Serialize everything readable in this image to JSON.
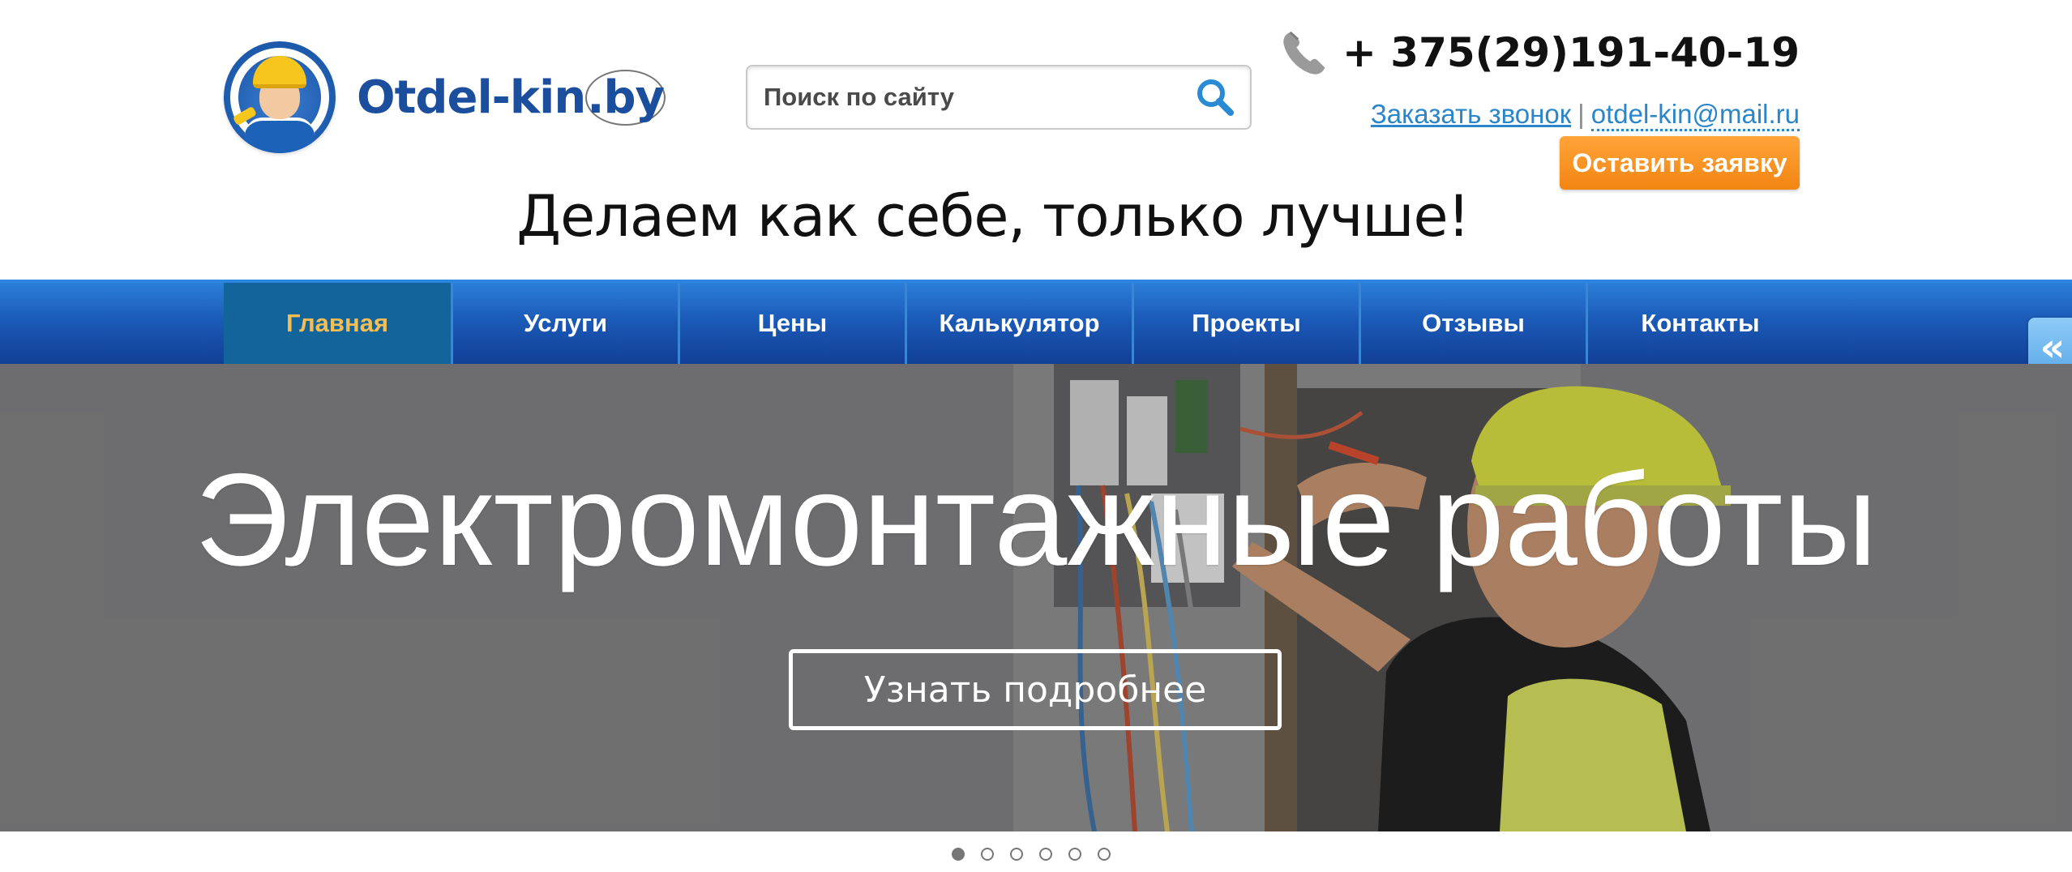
{
  "header": {
    "logo": {
      "text_main": "Otdel-kin",
      "text_suffix": ".by",
      "mascot_icon": "handyman-mascot-icon"
    },
    "search": {
      "placeholder": "Поиск по сайту",
      "icon": "search-icon"
    },
    "contact": {
      "phone": "+ 375(29)191-40-19",
      "phone_icon": "phone-handset-icon",
      "call_link": "Заказать звонок",
      "separator": "|",
      "email": "otdel-kin@mail.ru",
      "apply_button": "Оставить заявку"
    },
    "slogan": "Делаем как себе, только лучше!"
  },
  "nav": {
    "items": [
      {
        "label": "Главная",
        "active": true
      },
      {
        "label": "Услуги",
        "active": false
      },
      {
        "label": "Цены",
        "active": false
      },
      {
        "label": "Калькулятор",
        "active": false
      },
      {
        "label": "Проекты",
        "active": false
      },
      {
        "label": "Отзывы",
        "active": false
      },
      {
        "label": "Контакты",
        "active": false
      }
    ],
    "side_toggle_icon": "double-chevron-left-icon",
    "side_toggle_glyph": "«"
  },
  "hero": {
    "title": "Электромонтажные работы",
    "button": "Узнать подробнее",
    "slides_count": 6,
    "active_slide": 0
  },
  "colors": {
    "brand_blue": "#1c4e9e",
    "nav_blue": "#1a59b6",
    "nav_active_bg": "#13649a",
    "nav_active_text": "#f3bf54",
    "accent_orange": "#f28512",
    "link_blue": "#2a86c9"
  }
}
